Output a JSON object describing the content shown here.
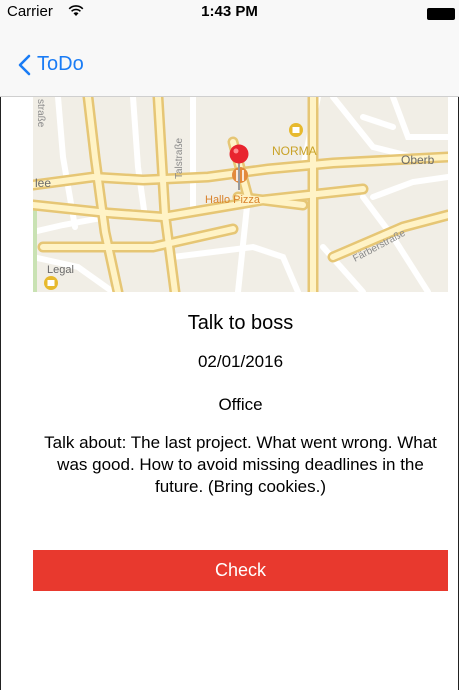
{
  "status_bar": {
    "carrier": "Carrier",
    "time": "1:43 PM"
  },
  "nav": {
    "back_label": "ToDo"
  },
  "map": {
    "labels": {
      "strasse_left": "straße",
      "talstrasse": "Talstraße",
      "norma": "NORMA",
      "oberb": "Oberb",
      "lee": "lee",
      "hallo_pizza": "Hallo Pizza",
      "farberstrasse": "Färberstraße",
      "legal": "Legal"
    }
  },
  "todo": {
    "title": "Talk to boss",
    "date": "02/01/2016",
    "location": "Office",
    "description": "Talk about: The last project. What went wrong. What was good. How to avoid missing deadlines in the future. (Bring cookies.)"
  },
  "actions": {
    "check_label": "Check"
  },
  "colors": {
    "accent": "#1a7cf5",
    "check_button": "#e8392e",
    "pin": "#e8242f"
  }
}
